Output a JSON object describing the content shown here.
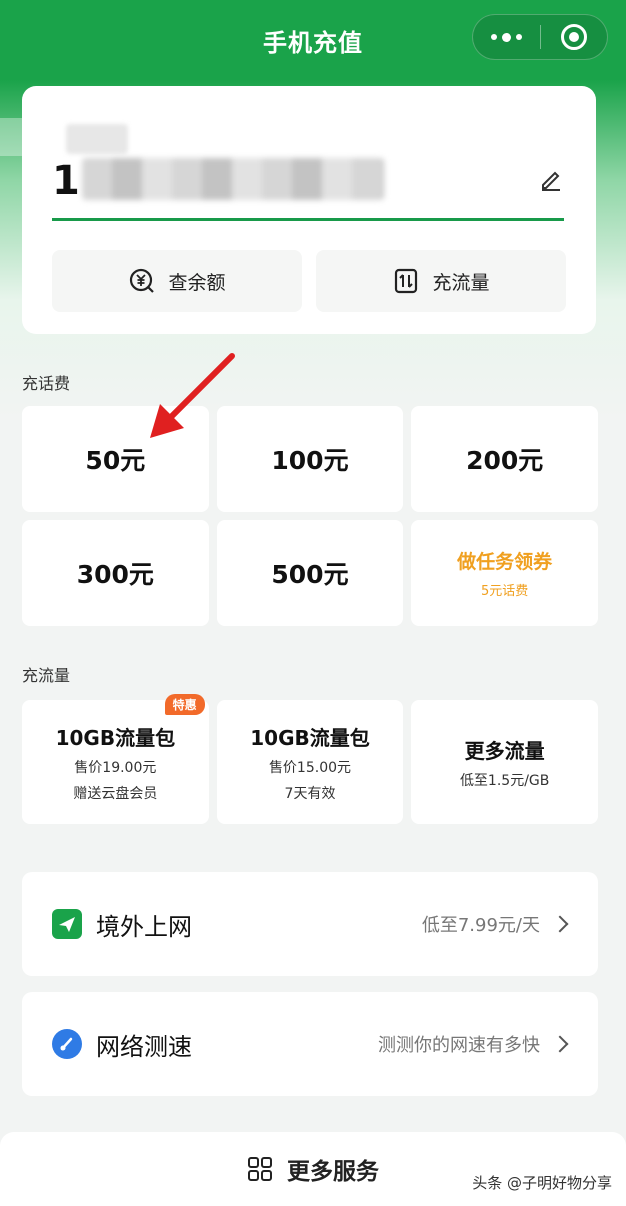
{
  "header": {
    "title": "手机充值"
  },
  "phone": {
    "prefix": "1"
  },
  "quick_actions": [
    {
      "label": "查余额",
      "icon": "yuan-search-icon"
    },
    {
      "label": "充流量",
      "icon": "data-transfer-icon"
    }
  ],
  "topup": {
    "section_label": "充话费",
    "amounts": [
      "50元",
      "100元",
      "200元",
      "300元",
      "500元"
    ],
    "promo": {
      "title": "做任务领券",
      "subtitle": "5元话费"
    }
  },
  "data_plans": {
    "section_label": "充流量",
    "items": [
      {
        "title": "10GB流量包",
        "price": "售价19.00元",
        "note": "赠送云盘会员",
        "badge": "特惠"
      },
      {
        "title": "10GB流量包",
        "price": "售价15.00元",
        "note": "7天有效"
      },
      {
        "title": "更多流量",
        "price": "低至1.5元/GB"
      }
    ]
  },
  "services": [
    {
      "title": "境外上网",
      "detail": "低至7.99元/天",
      "icon": "airplane-icon",
      "color": "#1aa34a"
    },
    {
      "title": "网络测速",
      "detail": "测测你的网速有多快",
      "icon": "speedometer-icon",
      "color": "#2f7be5"
    }
  ],
  "bottom": {
    "label": "更多服务"
  },
  "watermark": {
    "text": "头条 @子明好物分享"
  },
  "colors": {
    "brand": "#1aa34a",
    "accent": "#f0a020",
    "badge": "#f26a2a"
  }
}
